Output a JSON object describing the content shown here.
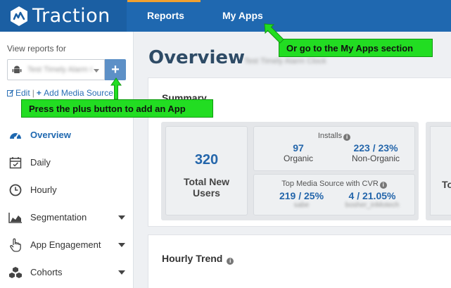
{
  "brand": {
    "name": "Traction"
  },
  "nav": {
    "reports_label": "Reports",
    "myapps_label": "My Apps"
  },
  "sidebar": {
    "view_reports_label": "View reports for",
    "selected_app": "Test Timely Alarm Clock",
    "add_button_symbol": "+",
    "edit_label": "Edit",
    "separator": "|",
    "add_media_label": "Add Media Source",
    "items": [
      {
        "label": "Overview",
        "icon": "dashboard-icon",
        "active": true
      },
      {
        "label": "Daily",
        "icon": "calendar-icon"
      },
      {
        "label": "Hourly",
        "icon": "clock-icon"
      },
      {
        "label": "Segmentation",
        "icon": "area-chart-icon",
        "has_dropdown": true
      },
      {
        "label": "App Engagement",
        "icon": "hand-pointer-icon",
        "has_dropdown": true
      },
      {
        "label": "Cohorts",
        "icon": "cubes-icon",
        "has_dropdown": true
      }
    ]
  },
  "main": {
    "title": "Overview",
    "subtitle": "Test Timely Alarm Clock",
    "summary": {
      "title": "Summary",
      "total": {
        "value": "320",
        "label": "Total New Users"
      },
      "installs": {
        "heading": "Installs",
        "organic_value": "97",
        "organic_label": "Organic",
        "nonorganic_value": "223 / 23%",
        "nonorganic_label": "Non-Organic"
      },
      "top_media": {
        "heading": "Top Media Source with CVR",
        "left_value": "219 / 25%",
        "left_source": "sabe",
        "right_value": "4 / 21.05%",
        "right_source": "bosher_inMotech"
      },
      "right_partial_label": "To"
    },
    "hourly_trend_title": "Hourly Trend"
  },
  "callouts": {
    "plus_text": "Press the plus button to add an App",
    "myapps_text": "Or go to the My Apps section"
  },
  "colors": {
    "topbar": "#1f68b0",
    "accent": "#2466ab",
    "callout": "#22dd22"
  }
}
